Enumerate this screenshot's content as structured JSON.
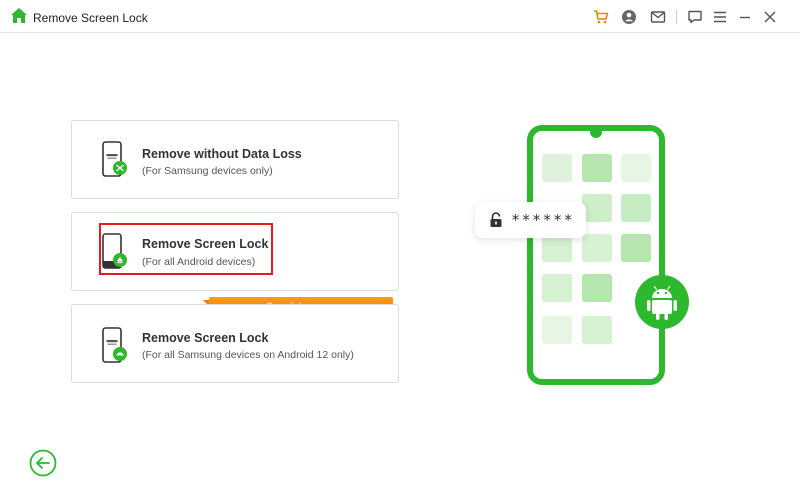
{
  "app": {
    "title": "Remove Screen Lock",
    "home_icon": "home-icon",
    "accent_color": "#2db82d"
  },
  "titlebar_actions": [
    {
      "name": "cart-icon",
      "color": "#f08300"
    },
    {
      "name": "account-icon"
    },
    {
      "name": "mail-icon"
    },
    {
      "name": "feedback-icon"
    },
    {
      "name": "menu-icon"
    },
    {
      "name": "minimize-icon"
    },
    {
      "name": "close-icon"
    }
  ],
  "options": [
    {
      "title": "Remove without Data Loss",
      "subtitle": "(For Samsung devices only)"
    },
    {
      "title": "Remove Screen Lock",
      "subtitle": "(For all Android devices)",
      "selected": true
    },
    {
      "title": "Remove Screen Lock",
      "subtitle": "(For all Samsung devices on Android 12 only)",
      "badge": "One-click remove"
    }
  ],
  "illustration": {
    "password_mask": "******",
    "lock_icon": "unlock-icon",
    "os_icon": "android-icon"
  },
  "footer": {
    "back_icon": "back-arrow-icon"
  }
}
